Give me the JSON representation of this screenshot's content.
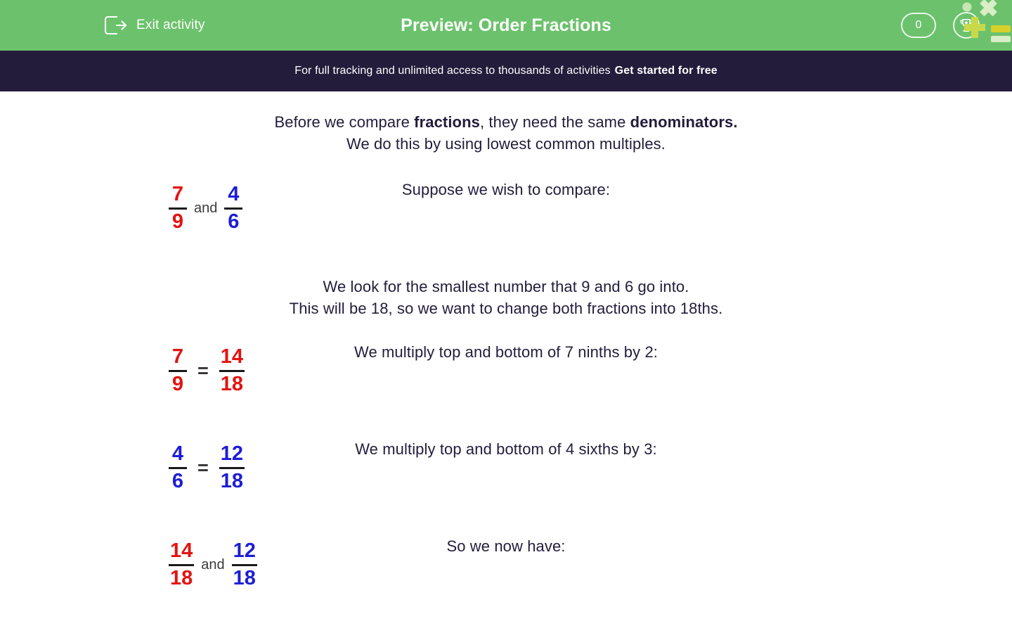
{
  "header": {
    "exit_label": "Exit activity",
    "exit_icon": "exit-logout-icon",
    "title": "Preview: Order Fractions",
    "score": "0",
    "trophy_icon": "trophy-icon",
    "decor_icon": "math-symbols-decoration",
    "background_color": "#6cc26c"
  },
  "promo": {
    "text": "For full tracking and unlimited access to thousands of activities",
    "cta_label": "Get started for free",
    "background_color": "#231c3b"
  },
  "colors": {
    "red": "#e4130f",
    "blue": "#1d1dd6",
    "text": "#231c3b"
  },
  "lesson": {
    "intro_line_1_a": "Before we compare ",
    "intro_line_1_b": "fractions",
    "intro_line_1_c": ", they need the same ",
    "intro_line_1_d": "denominators.",
    "intro_line_2": "We do this by using lowest common multiples.",
    "steps": [
      {
        "caption": "Suppose we wish to compare:",
        "kind": "and",
        "left": {
          "numerator": "7",
          "denominator": "9",
          "color": "red"
        },
        "operator": "and",
        "right": {
          "numerator": "4",
          "denominator": "6",
          "color": "blue"
        }
      },
      {
        "caption_line_1": "We look for the smallest number that 9 and 6 go into.",
        "caption_line_2": "This will be 18, so we want to change both fractions into 18ths.",
        "kind": "text-only"
      },
      {
        "caption": "We multiply top and bottom of 7 ninths by 2:",
        "kind": "equals",
        "left": {
          "numerator": "7",
          "denominator": "9",
          "color": "red"
        },
        "operator": "=",
        "right": {
          "numerator": "14",
          "denominator": "18",
          "color": "red"
        }
      },
      {
        "caption": "We multiply top and bottom of 4 sixths by 3:",
        "kind": "equals",
        "left": {
          "numerator": "4",
          "denominator": "6",
          "color": "blue"
        },
        "operator": "=",
        "right": {
          "numerator": "12",
          "denominator": "18",
          "color": "blue"
        }
      },
      {
        "caption": "So we now have:",
        "kind": "and",
        "left": {
          "numerator": "14",
          "denominator": "18",
          "color": "red"
        },
        "operator": "and",
        "right": {
          "numerator": "12",
          "denominator": "18",
          "color": "blue"
        }
      }
    ]
  }
}
